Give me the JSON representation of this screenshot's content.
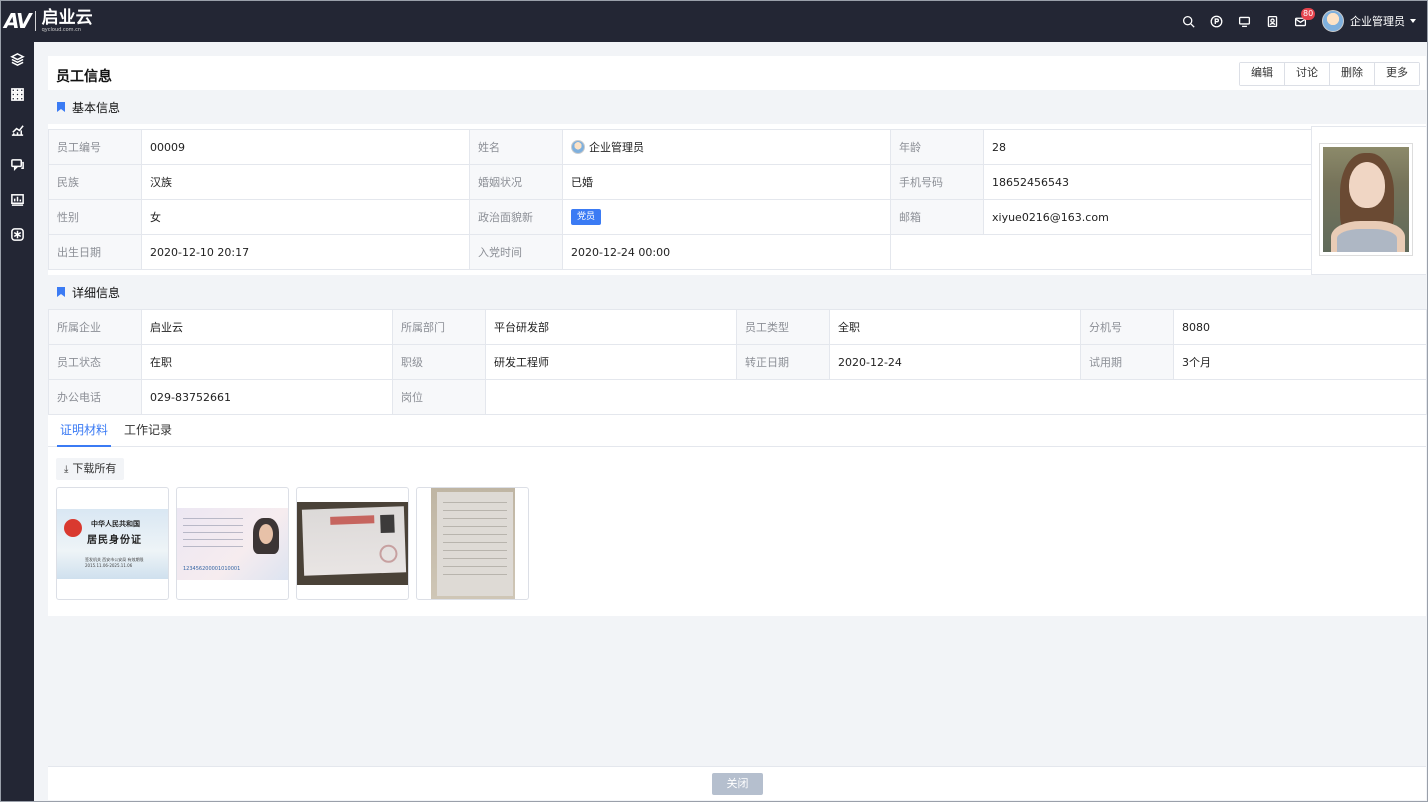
{
  "app": {
    "logo_text": "启业云",
    "logo_url": "qycloud.com.cn",
    "notification_count": "80",
    "user_name": "企业管理员",
    "top_icons": [
      "search-icon",
      "p-circle-icon",
      "monitor-icon",
      "contact-icon",
      "mail-icon"
    ],
    "sidebar_icons": [
      "layers-icon",
      "grid-icon",
      "chart-icon",
      "chat-icon",
      "screen-icon",
      "snowflake-icon"
    ]
  },
  "page": {
    "title": "员工信息",
    "actions": [
      "编辑",
      "讨论",
      "删除",
      "更多"
    ]
  },
  "basic": {
    "section_title": "基本信息",
    "rows": [
      [
        {
          "label": "员工编号",
          "value": "00009"
        },
        {
          "label": "姓名",
          "value": "企业管理员"
        },
        {
          "label": "年龄",
          "value": "28"
        }
      ],
      [
        {
          "label": "民族",
          "value": "汉族"
        },
        {
          "label": "婚姻状况",
          "value": "已婚"
        },
        {
          "label": "手机号码",
          "value": "18652456543"
        }
      ],
      [
        {
          "label": "性别",
          "value": "女"
        },
        {
          "label": "政治面貌新",
          "value": "党员"
        },
        {
          "label": "邮箱",
          "value": "xiyue0216@163.com"
        }
      ],
      [
        {
          "label": "出生日期",
          "value": "2020-12-10 20:17"
        },
        {
          "label": "入党时间",
          "value": "2020-12-24 00:00"
        }
      ]
    ]
  },
  "detail": {
    "section_title": "详细信息",
    "rows": [
      [
        {
          "label": "所属企业",
          "value": "启业云"
        },
        {
          "label": "所属部门",
          "value": "平台研发部"
        },
        {
          "label": "员工类型",
          "value": "全职"
        },
        {
          "label": "分机号",
          "value": "8080"
        }
      ],
      [
        {
          "label": "员工状态",
          "value": "在职"
        },
        {
          "label": "职级",
          "value": "研发工程师"
        },
        {
          "label": "转正日期",
          "value": "2020-12-24"
        },
        {
          "label": "试用期",
          "value": "3个月"
        }
      ],
      [
        {
          "label": "办公电话",
          "value": "029-83752661"
        },
        {
          "label": "岗位",
          "value": ""
        }
      ]
    ]
  },
  "tabs": [
    "证明材料",
    "工作记录"
  ],
  "materials": {
    "download_label": "下载所有",
    "id_front_line1": "中华人民共和国",
    "id_front_line2": "居民身份证",
    "id_front_line3": "签发机关  西安市公安局  有效期限  2015.11.06-2025.11.06",
    "id_back_number": "123456200001010001",
    "diploma_title": "毕业证书"
  },
  "footer": {
    "close_label": "关闭"
  }
}
